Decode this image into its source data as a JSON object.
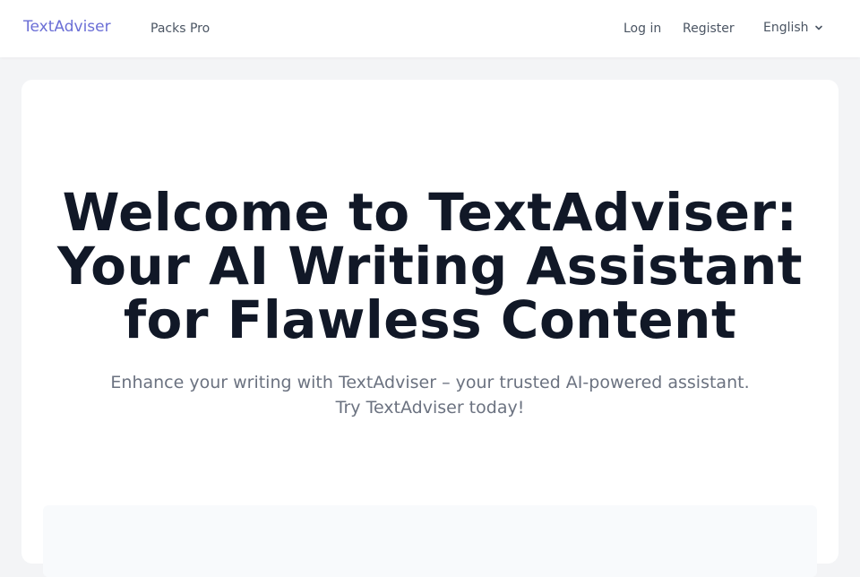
{
  "header": {
    "logo": "TextAdviser",
    "nav": {
      "packs_pro": "Packs Pro",
      "login": "Log in",
      "register": "Register"
    },
    "language": {
      "selected": "English",
      "icon": "chevron-down-icon"
    }
  },
  "hero": {
    "title_line1": "Welcome to TextAdviser:",
    "title_line2": "Your AI Writing Assistant",
    "title_line3": "for Flawless Content",
    "subtitle_line1": "Enhance your writing with TextAdviser – your trusted AI-powered assistant.",
    "subtitle_line2": "Try TextAdviser today!"
  },
  "colors": {
    "brand": "#6b6fd6",
    "title": "#111827",
    "muted": "#6b7280",
    "page_bg": "#f3f4f6"
  }
}
